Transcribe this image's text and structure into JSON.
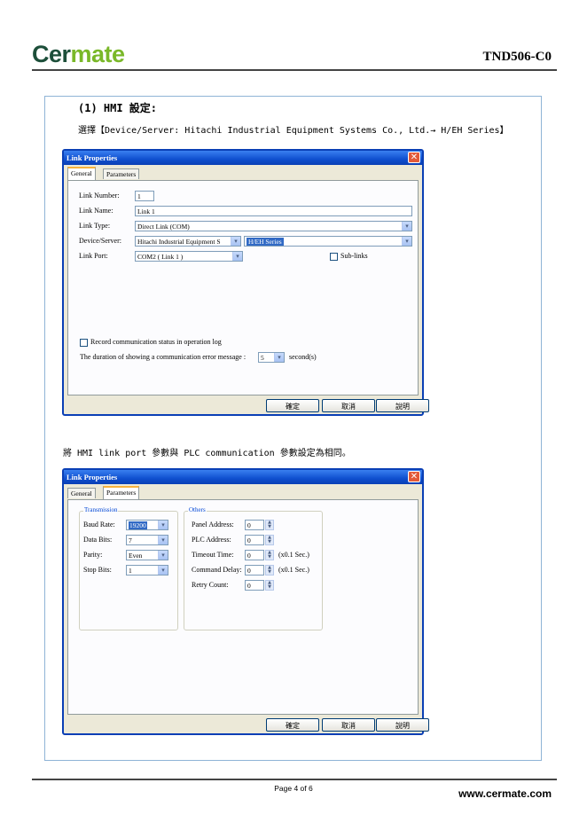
{
  "header": {
    "logo_part1": "Cer",
    "logo_part2": "mate",
    "doc_id": "TND506-C0"
  },
  "section": {
    "title": "(1) HMI 設定:",
    "instruction": "選擇【Device/Server: Hitachi Industrial Equipment Systems Co., Ltd.→ H/EH Series】"
  },
  "dialog1": {
    "title": "Link Properties",
    "tabs": [
      "General",
      "Parameters"
    ],
    "labels": {
      "link_number": "Link Number:",
      "link_name": "Link Name:",
      "link_type": "Link Type:",
      "device_server": "Device/Server:",
      "link_port": "Link Port:"
    },
    "values": {
      "link_number": "1",
      "link_name": "Link 1",
      "link_type": "Direct Link (COM)",
      "device_server_vendor": "Hitachi Industrial Equipment S",
      "device_server_series": "H/EH Series",
      "link_port": "COM2 ( Link 1 )"
    },
    "sub_links_label": "Sub-links",
    "record_label": "Record communication status in operation log",
    "duration_label": "The duration of showing a communication error message :",
    "duration_value": "5",
    "duration_unit": "second(s)",
    "buttons": {
      "ok": "確定",
      "cancel": "取消",
      "help": "說明"
    }
  },
  "paragraph": "將 HMI link port 參數與 PLC communication 參數設定為相同。",
  "dialog2": {
    "title": "Link Properties",
    "tabs": [
      "General",
      "Parameters"
    ],
    "transmission": {
      "title": "Transmission",
      "baud_rate_label": "Baud Rate:",
      "baud_rate": "19200",
      "data_bits_label": "Data Bits:",
      "data_bits": "7",
      "parity_label": "Parity:",
      "parity": "Even",
      "stop_bits_label": "Stop Bits:",
      "stop_bits": "1"
    },
    "others": {
      "title": "Others",
      "panel_address_label": "Panel Address:",
      "panel_address": "0",
      "plc_address_label": "PLC Address:",
      "plc_address": "0",
      "timeout_label": "Timeout Time:",
      "timeout": "0",
      "timeout_unit": "(x0.1 Sec.)",
      "cmd_delay_label": "Command Delay:",
      "cmd_delay": "0",
      "cmd_delay_unit": "(x0.1 Sec.)",
      "retry_label": "Retry Count:",
      "retry": "0"
    },
    "buttons": {
      "ok": "確定",
      "cancel": "取消",
      "help": "說明"
    }
  },
  "footer": {
    "page": "Page 4 of 6",
    "url": "www.cermate.com"
  }
}
